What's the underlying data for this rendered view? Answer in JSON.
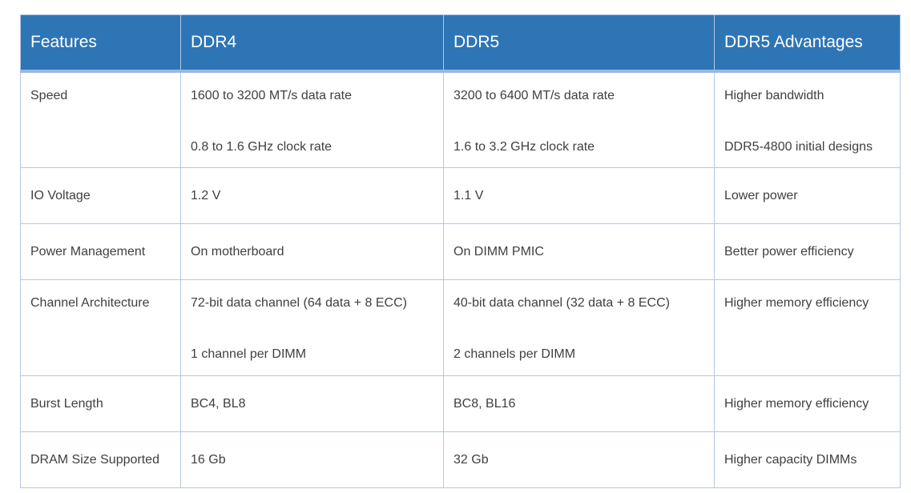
{
  "table": {
    "headers": [
      "Features",
      "DDR4",
      "DDR5",
      "DDR5 Advantages"
    ],
    "rows": [
      {
        "feature": "Speed",
        "ddr4": [
          "1600 to 3200 MT/s data rate",
          "0.8 to 1.6 GHz clock rate"
        ],
        "ddr5": [
          "3200 to 6400 MT/s data rate",
          "1.6 to 3.2 GHz clock rate"
        ],
        "advantage": [
          "Higher bandwidth",
          "DDR5-4800 initial designs"
        ]
      },
      {
        "feature": "IO Voltage",
        "ddr4": [
          "1.2 V"
        ],
        "ddr5": [
          "1.1 V"
        ],
        "advantage": [
          "Lower power"
        ]
      },
      {
        "feature": "Power Management",
        "ddr4": [
          "On motherboard"
        ],
        "ddr5": [
          "On DIMM PMIC"
        ],
        "advantage": [
          "Better power efficiency"
        ]
      },
      {
        "feature": "Channel Architecture",
        "ddr4": [
          "72-bit data channel (64 data + 8 ECC)",
          "1 channel per DIMM"
        ],
        "ddr5": [
          "40-bit data channel (32 data + 8 ECC)",
          "2 channels per DIMM"
        ],
        "advantage": [
          "Higher memory efficiency"
        ]
      },
      {
        "feature": "Burst Length",
        "ddr4": [
          "BC4, BL8"
        ],
        "ddr5": [
          "BC8, BL16"
        ],
        "advantage": [
          "Higher memory efficiency"
        ]
      },
      {
        "feature": "DRAM Size Supported",
        "ddr4": [
          "16 Gb"
        ],
        "ddr5": [
          "32 Gb"
        ],
        "advantage": [
          "Higher capacity DIMMs"
        ]
      }
    ]
  },
  "colors": {
    "header_bg": "#2E75B6",
    "border": "#B4C6E7",
    "text": "#404040"
  }
}
